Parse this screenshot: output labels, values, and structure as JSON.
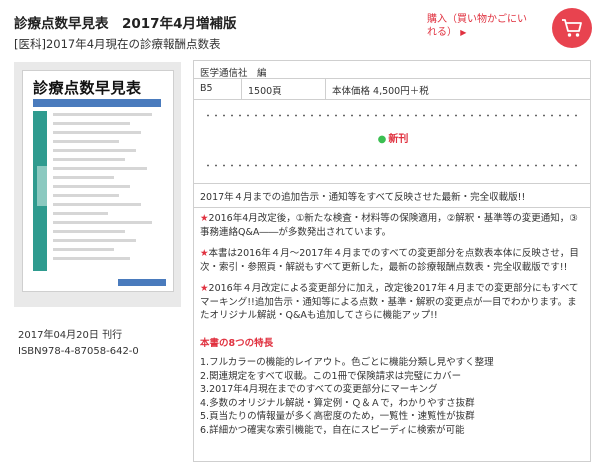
{
  "header": {
    "title": "診療点数早見表　2017年4月増補版",
    "subtitle": "[医科]2017年4月現在の診療報酬点数表",
    "buy_link": "購入（買い物かごにいれる）",
    "buy_arrow": "▶"
  },
  "cover": {
    "title": "診療点数早見表"
  },
  "book": {
    "pub_date": "2017年04月20日 刊行",
    "isbn": "ISBN978-4-87058-642-0"
  },
  "panel": {
    "publisher": "医学通信社　編",
    "size": "B5",
    "pages": "1500頁",
    "price": "本体価格 4,500円＋税",
    "new_label": "新刊",
    "new_bullet": "●",
    "summary": "2017年４月までの追加告示・通知等をすべて反映させた最新・完全収載版!!",
    "star": "★",
    "desc1": "2016年4月改定後，①新たな検査・材料等の保険適用，②解釈・基準等の変更通知，③事務連絡Q&A――が多数発出されています。",
    "desc2": "本書は2016年４月～2017年４月までのすべての変更部分を点数表本体に反映させ，目次・索引・参照頁・解説もすべて更新した，最新の診療報酬点数表・完全収載版です!!",
    "desc3": "2016年４月改定による変更部分に加え，改定後2017年４月までの変更部分にもすべてマーキング!!追加告示・通知等による点数・基準・解釈の変更点が一目でわかります。またオリジナル解説・Q&Aも追加してさらに機能アップ!!",
    "features_heading": "本書の8つの特長",
    "features": [
      "1.フルカラーの機能的レイアウト。色ごとに機能分類し見やすく整理",
      "2.関連規定をすべて収載。この1冊で保険請求は完璧にカバー",
      "3.2017年4月現在までのすべての変更部分にマーキング",
      "4.多数のオリジナル解説・算定例・Ｑ＆Ａで，わかりやすさ抜群",
      "5.頁当たりの情報量が多く高密度のため，一覧性・速覧性が抜群",
      "6.詳細かつ確実な索引機能で，自在にスピーディに検索が可能"
    ]
  },
  "colors": {
    "accent": "#e0313f",
    "cart": "#e8434f",
    "new_bullet": "#3bbf52"
  }
}
